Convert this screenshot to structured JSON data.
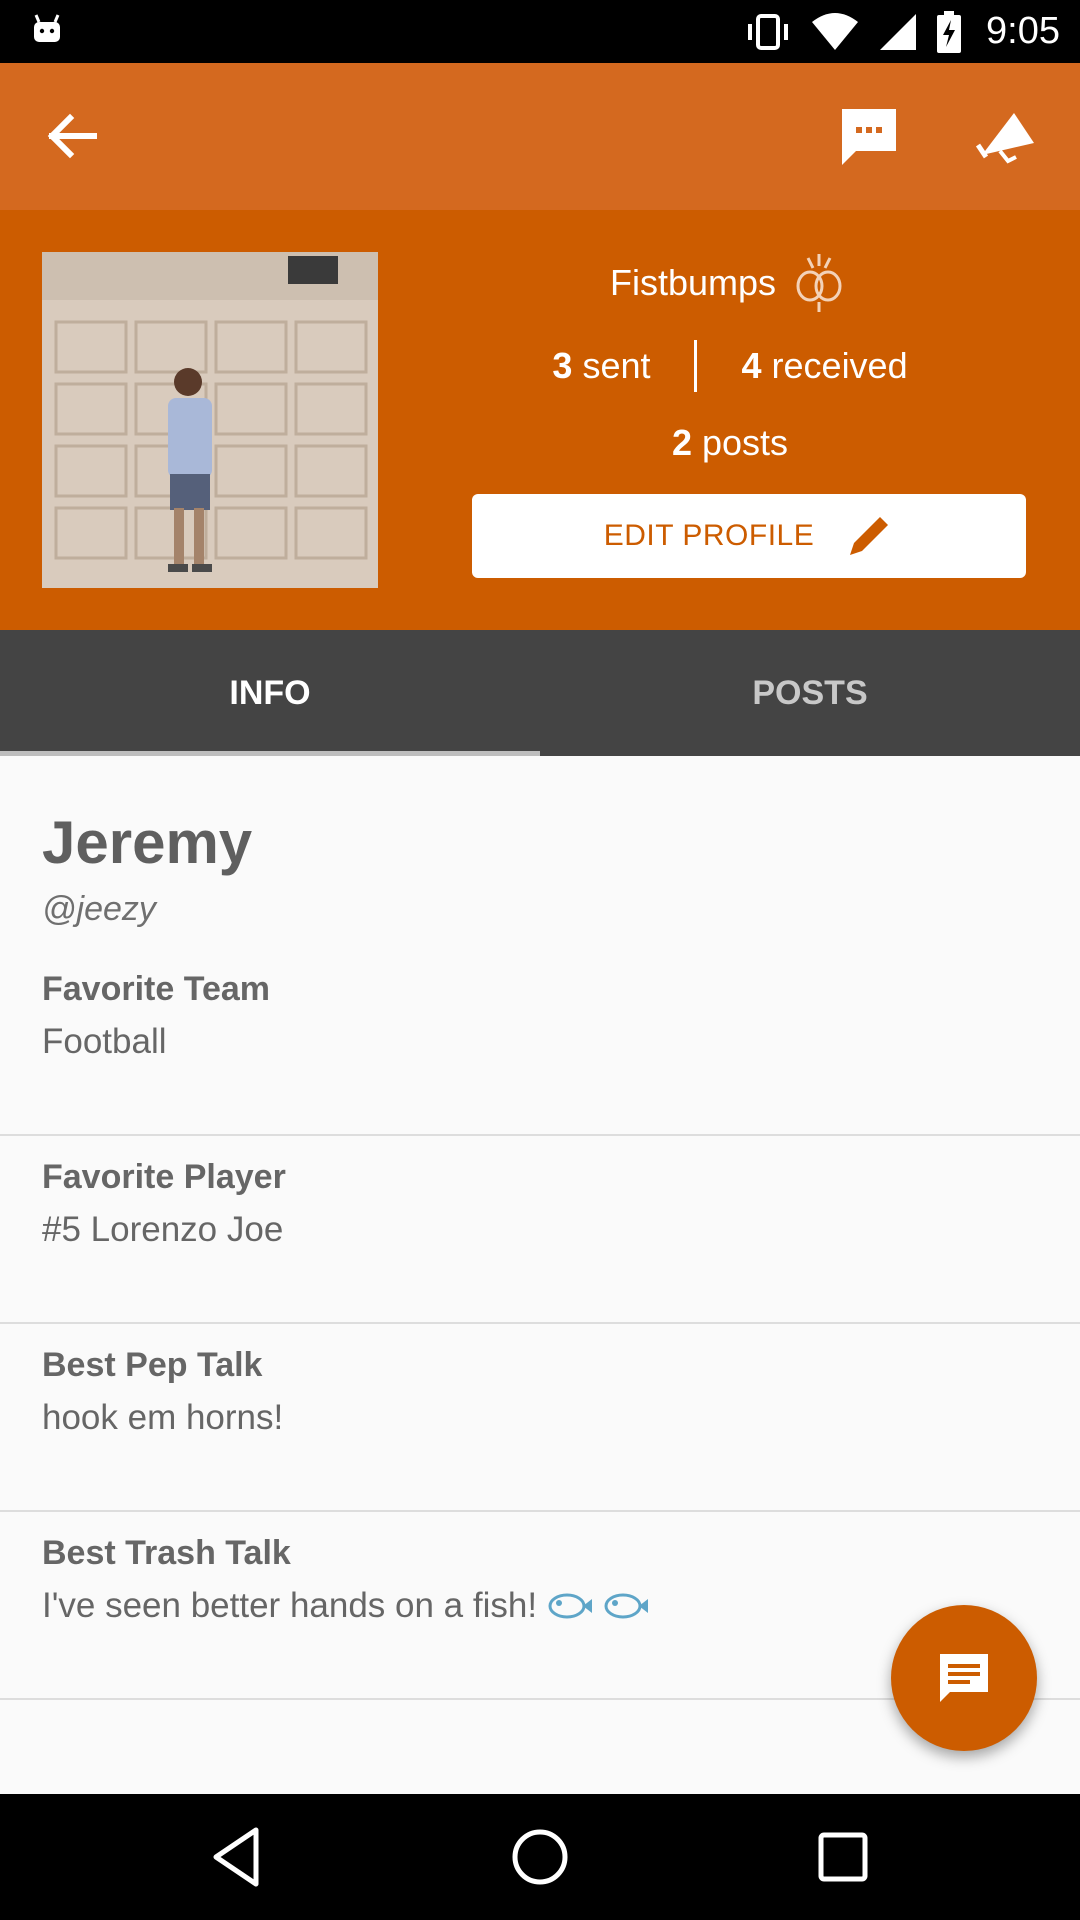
{
  "status_bar": {
    "time": "9:05"
  },
  "profile": {
    "fistbumps_label": "Fistbumps",
    "sent_count": "3",
    "sent_label": "sent",
    "received_count": "4",
    "received_label": "received",
    "posts_count": "2",
    "posts_label": "posts",
    "edit_label": "EDIT PROFILE"
  },
  "tabs": [
    {
      "label": "INFO",
      "active": true
    },
    {
      "label": "POSTS",
      "active": false
    }
  ],
  "user": {
    "name": "Jeremy",
    "handle": "@jeezy"
  },
  "fields": [
    {
      "label": "Favorite Team",
      "value": "Football"
    },
    {
      "label": "Favorite Player",
      "value": "#5 Lorenzo Joe"
    },
    {
      "label": "Best Pep Talk",
      "value": "hook em horns!"
    },
    {
      "label": "Best Trash Talk",
      "value": "I've seen better hands on a fish!"
    }
  ],
  "colors": {
    "app_bar": "#d4691f",
    "brand": "#cc5c00",
    "tab_bar": "#444444"
  },
  "icons": {
    "back": "arrow-back-icon",
    "chat": "chat-bubble-icon",
    "megaphone": "megaphone-icon",
    "fistbump": "fistbump-icon",
    "edit": "pencil-icon",
    "fab": "message-icon"
  }
}
